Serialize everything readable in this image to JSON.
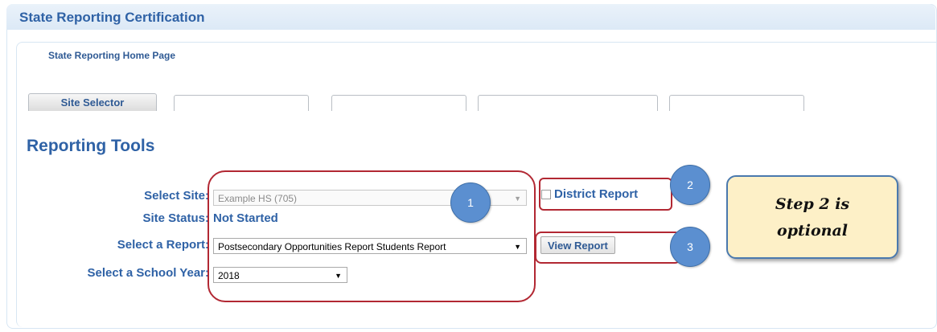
{
  "header": {
    "title": "State Reporting Certification"
  },
  "nav": {
    "home_link": "State Reporting Home Page"
  },
  "tabs": [
    {
      "label": "Site Selector",
      "active": true
    },
    {
      "label": "",
      "active": false
    },
    {
      "label": "",
      "active": false
    },
    {
      "label": "",
      "active": false
    },
    {
      "label": "",
      "active": false
    }
  ],
  "reporting_tools": {
    "heading": "Reporting Tools",
    "select_site": {
      "label": "Select Site:",
      "value": "Example HS (705)",
      "disabled": true
    },
    "site_status": {
      "label": "Site Status:",
      "value": "Not Started"
    },
    "select_report": {
      "label": "Select a Report:",
      "value": "Postsecondary Opportunities Report Students Report"
    },
    "select_year": {
      "label": "Select a School Year:",
      "value": "2018"
    },
    "district_report": {
      "label": "District Report",
      "checked": false
    },
    "view_report_button": "View Report"
  },
  "annotations": {
    "step_markers": [
      "1",
      "2",
      "3"
    ],
    "callout_line1": "Step 2 is",
    "callout_line2": "optional",
    "colors": {
      "outline": "#b22833",
      "marker_fill": "#5b8fd0",
      "callout_fill": "#fdf0c7",
      "callout_border": "#4a79ae"
    }
  },
  "colors": {
    "heading_blue": "#2f62a6",
    "panel_border": "#d7e6f3"
  }
}
